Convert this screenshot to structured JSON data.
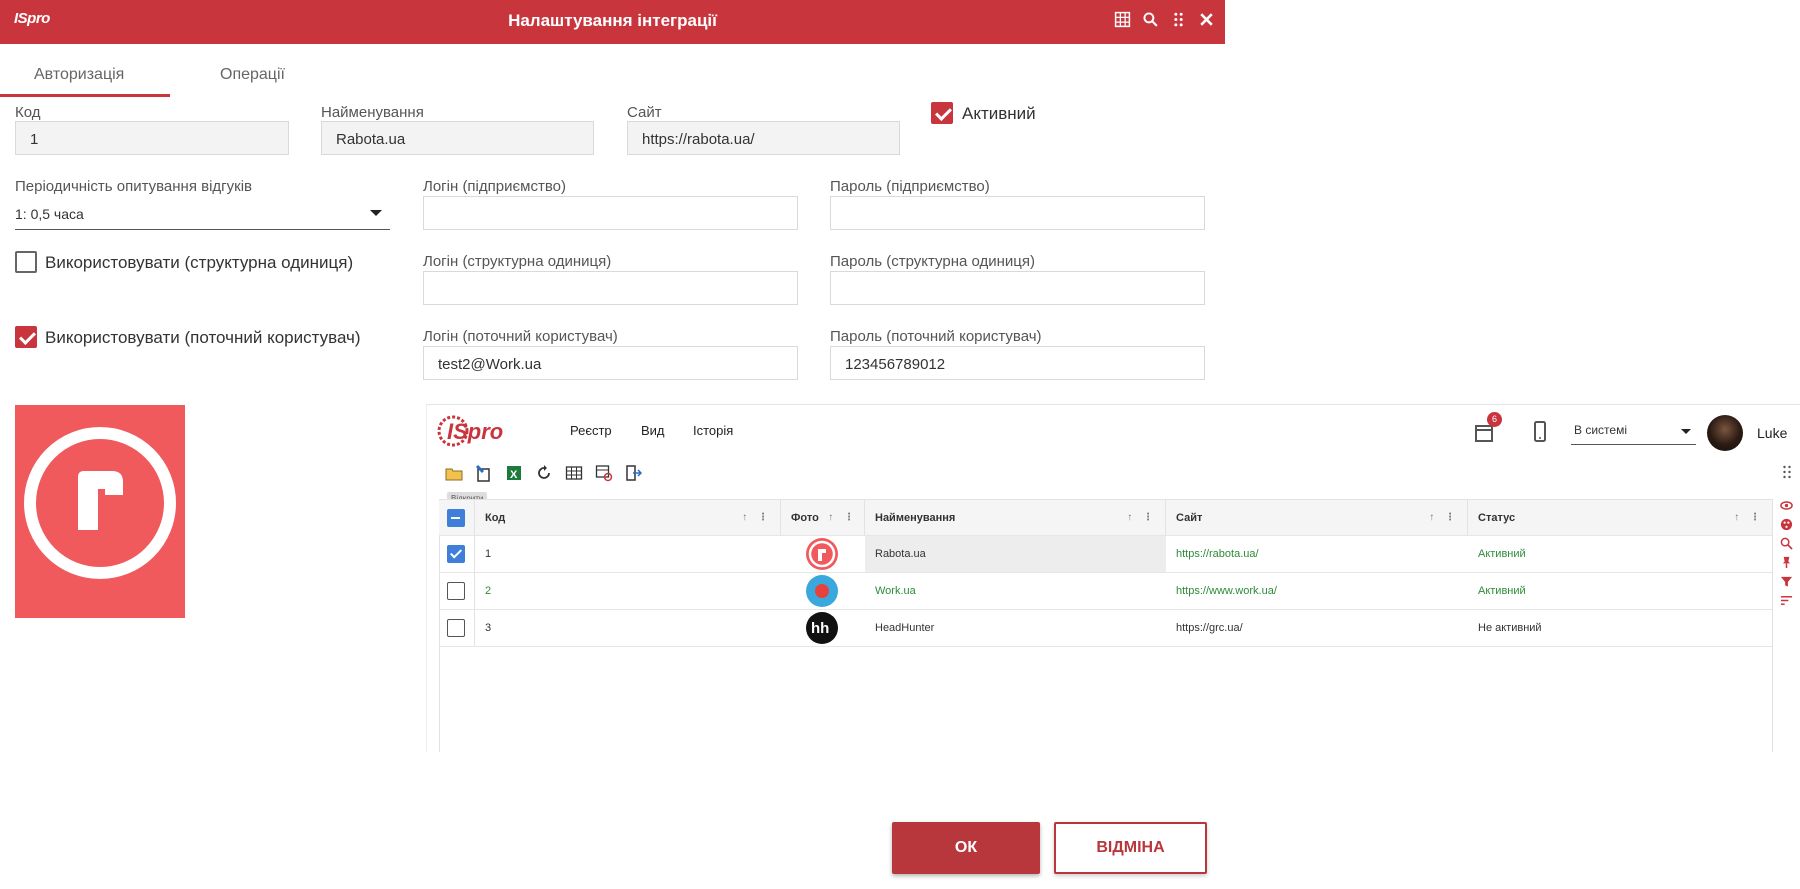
{
  "window": {
    "logo_text": "ISpro",
    "title": "Налаштування інтеграції"
  },
  "tabs": [
    {
      "label": "Авторизація",
      "active": true
    },
    {
      "label": "Операції",
      "active": false
    }
  ],
  "form": {
    "code_label": "Код",
    "code_value": "1",
    "name_label": "Найменування",
    "name_value": "Rabota.ua",
    "site_label": "Сайт",
    "site_value": "https://rabota.ua/",
    "active_label": "Активний",
    "active_checked": true,
    "poll_label": "Періодичність опитування відгуків",
    "poll_value": "1: 0,5 часа",
    "login_company_label": "Логін (підприємство)",
    "login_company_value": "",
    "password_company_label": "Пароль (підприємство)",
    "password_company_value": "",
    "use_unit_label": "Використовувати (структурна одиниця)",
    "use_unit_checked": false,
    "login_unit_label": "Логін (структурна одиниця)",
    "login_unit_value": "",
    "password_unit_label": "Пароль (структурна одиниця)",
    "password_unit_value": "",
    "use_user_label": "Використовувати (поточний користувач)",
    "use_user_checked": true,
    "login_user_label": "Логін (поточний користувач)",
    "login_user_value": "test2@Work.ua",
    "password_user_label": "Пароль (поточний користувач)",
    "password_user_value": "123456789012"
  },
  "app": {
    "logo_text": "ISpro",
    "menu": [
      "Реєстр",
      "Вид",
      "Історія"
    ],
    "badge_count": "6",
    "status_value": "В системі",
    "user_name": "Luke",
    "tooltip": "Відкрити",
    "columns": [
      "Код",
      "Фото",
      "Найменування",
      "Сайт",
      "Статус"
    ],
    "rows": [
      {
        "code": "1",
        "name": "Rabota.ua",
        "site": "https://rabota.ua/",
        "status": "Активний",
        "checked": true,
        "logo": "rabota-logo"
      },
      {
        "code": "2",
        "name": "Work.ua",
        "site": "https://www.work.ua/",
        "status": "Активний",
        "checked": false,
        "logo": "workua-logo"
      },
      {
        "code": "3",
        "name": "HeadHunter",
        "site": "https://grc.ua/",
        "status": "Не активний",
        "checked": false,
        "logo": "headhunter-logo"
      }
    ]
  },
  "buttons": {
    "ok": "ОК",
    "cancel": "ВІДМІНА"
  },
  "colors": {
    "accent": "#c8353c",
    "rabota": "#f15a5d",
    "grid_check": "#3f7fd9",
    "active_status": "#2e8b3a"
  }
}
